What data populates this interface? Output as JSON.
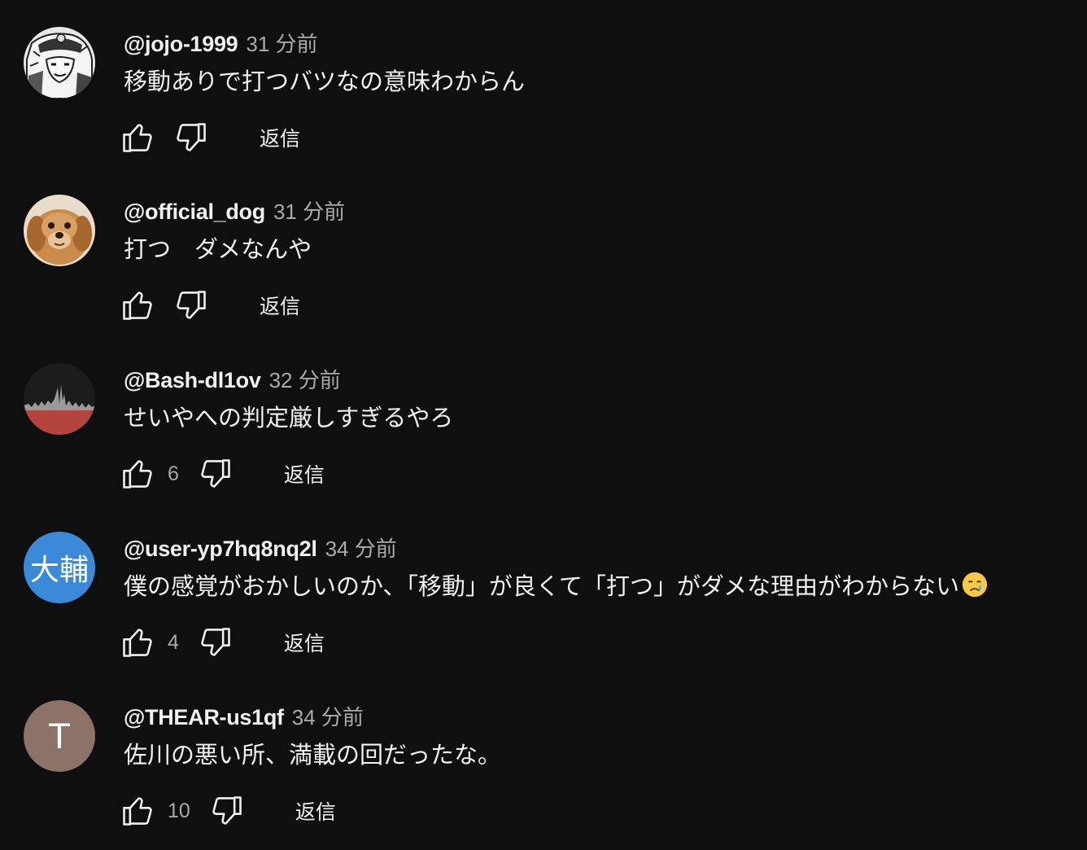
{
  "comments": [
    {
      "author": "@jojo-1999",
      "time": "31 分前",
      "text": "移動ありで打つバツなの意味わからん",
      "likes": "",
      "reply_label": "返信",
      "avatar": {
        "type": "image",
        "icon": "manga-character-avatar",
        "bg": "#d9d9d9"
      }
    },
    {
      "author": "@official_dog",
      "time": "31 分前",
      "text": "打つ　ダメなんや",
      "likes": "",
      "reply_label": "返信",
      "avatar": {
        "type": "image",
        "icon": "dog-photo-avatar",
        "bg": "#c98a4a"
      }
    },
    {
      "author": "@Bash-dl1ov",
      "time": "32 分前",
      "text": "せいやへの判定厳しすぎるやろ",
      "likes": "6",
      "reply_label": "返信",
      "avatar": {
        "type": "image",
        "icon": "waveform-avatar",
        "bg": "#1c1c1c",
        "accent": "#b5443f"
      }
    },
    {
      "author": "@user-yp7hq8nq2l",
      "time": "34 分前",
      "text": "僕の感覚がおかしいのか、「移動」が良くて「打つ」がダメな理由がわからない",
      "likes": "4",
      "reply_label": "返信",
      "avatar": {
        "type": "letter",
        "letter": "大輔",
        "bg": "#3b8ad9"
      },
      "emoji": "crying-face-emoji"
    },
    {
      "author": "@THEAR-us1qf",
      "time": "34 分前",
      "text": "佐川の悪い所、満載の回だったな。",
      "likes": "10",
      "reply_label": "返信",
      "avatar": {
        "type": "letter",
        "letter": "T",
        "bg": "#8d7268"
      }
    }
  ],
  "icons": {
    "like": "thumbs-up-icon",
    "dislike": "thumbs-down-icon"
  },
  "colors": {
    "background": "#0f0f0f",
    "primary_text": "#f1f1f1",
    "secondary_text": "#aaaaaa"
  }
}
